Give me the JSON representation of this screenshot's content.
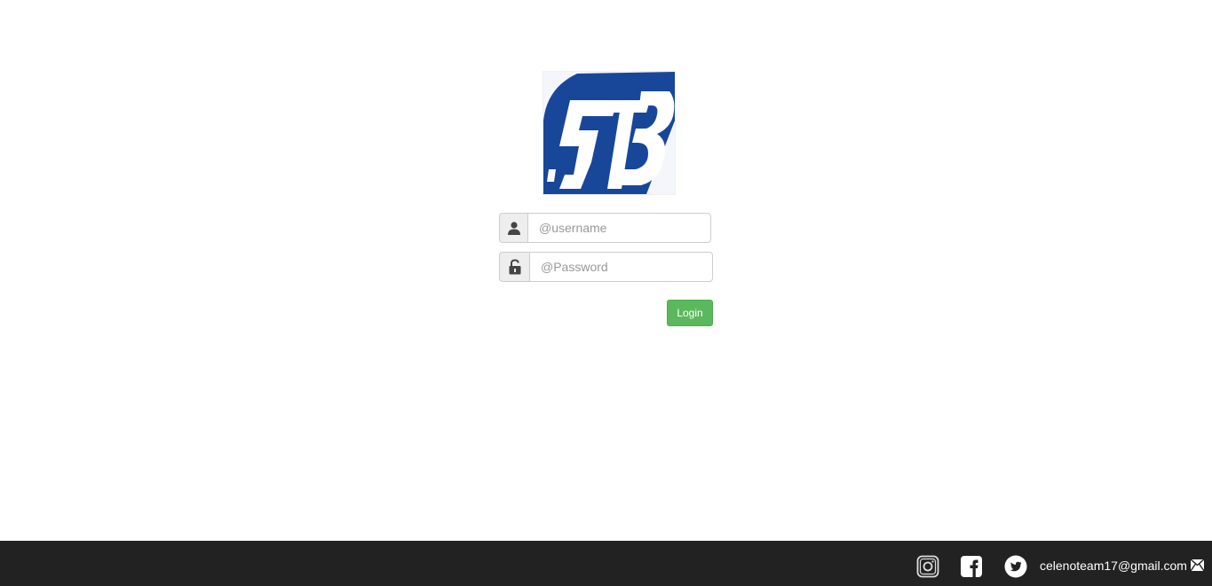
{
  "login_form": {
    "username_placeholder": "@username",
    "password_placeholder": "@Password",
    "login_label": "Login"
  },
  "footer": {
    "email": "celenoteam17@gmail.com",
    "icons": [
      "instagram-icon",
      "facebook-icon",
      "twitter-icon",
      "mail-icon"
    ]
  },
  "colors": {
    "logo_blue": "#18479a",
    "login_button": "#5cb85c",
    "footer_background": "#222222"
  }
}
